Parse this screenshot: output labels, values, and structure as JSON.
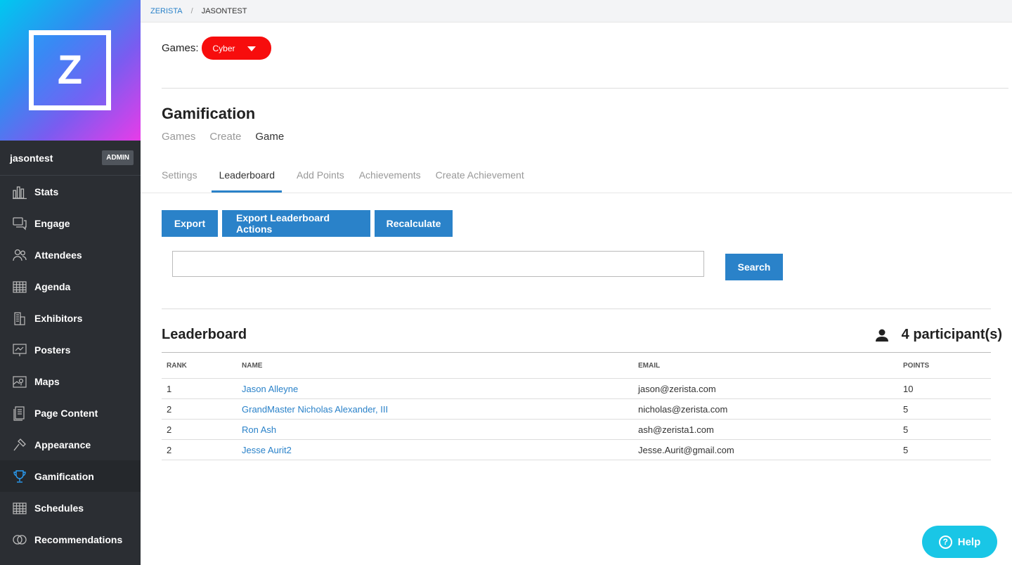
{
  "sidebar": {
    "logo_letter": "Z",
    "username": "jasontest",
    "badge": "ADMIN",
    "items": [
      {
        "label": "Stats",
        "icon": "bar-chart-icon"
      },
      {
        "label": "Engage",
        "icon": "chat-icon"
      },
      {
        "label": "Attendees",
        "icon": "people-icon"
      },
      {
        "label": "Agenda",
        "icon": "calendar-grid-icon"
      },
      {
        "label": "Exhibitors",
        "icon": "building-icon"
      },
      {
        "label": "Posters",
        "icon": "presentation-icon"
      },
      {
        "label": "Maps",
        "icon": "map-icon"
      },
      {
        "label": "Page Content",
        "icon": "document-icon"
      },
      {
        "label": "Appearance",
        "icon": "hammer-icon"
      },
      {
        "label": "Gamification",
        "icon": "trophy-icon",
        "active": true
      },
      {
        "label": "Schedules",
        "icon": "calendar-grid-icon"
      },
      {
        "label": "Recommendations",
        "icon": "recommend-icon"
      }
    ]
  },
  "breadcrumb": {
    "root": "ZERISTA",
    "sep": "/",
    "current": "JASONTEST"
  },
  "games": {
    "label": "Games:",
    "selected": "Cyber"
  },
  "page": {
    "title": "Gamification",
    "subnav": [
      "Games",
      "Create",
      "Game"
    ],
    "tabs": [
      "Settings",
      "Leaderboard",
      "Add Points",
      "Achievements",
      "Create Achievement"
    ],
    "active_tab": "Leaderboard"
  },
  "actions": {
    "export": "Export",
    "export_actions": "Export Leaderboard Actions",
    "recalculate": "Recalculate"
  },
  "search": {
    "value": "",
    "button": "Search"
  },
  "leaderboard": {
    "title": "Leaderboard",
    "participants": "4 participant(s)",
    "columns": [
      "RANK",
      "NAME",
      "EMAIL",
      "POINTS"
    ],
    "rows": [
      {
        "rank": "1",
        "name": "Jason Alleyne",
        "email": "jason@zerista.com",
        "points": "10"
      },
      {
        "rank": "2",
        "name": "GrandMaster Nicholas Alexander, III",
        "email": "nicholas@zerista.com",
        "points": "5"
      },
      {
        "rank": "2",
        "name": "Ron Ash",
        "email": "ash@zerista1.com",
        "points": "5"
      },
      {
        "rank": "2",
        "name": "Jesse Aurit2",
        "email": "Jesse.Aurit@gmail.com",
        "points": "5"
      }
    ]
  },
  "help": {
    "label": "Help"
  },
  "colors": {
    "accent": "#2a82c9",
    "games_select": "#f70d0d",
    "help": "#19c6e6",
    "sidebar": "#2b2e33"
  }
}
